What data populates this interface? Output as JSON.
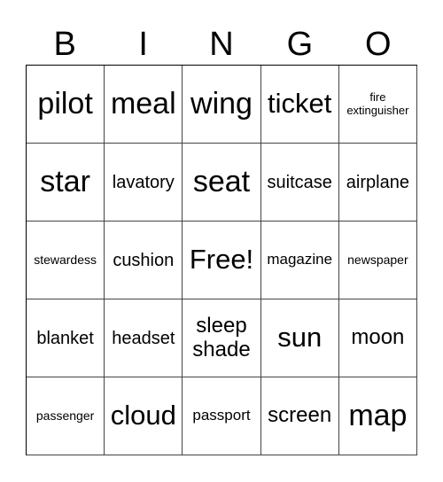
{
  "header": [
    "B",
    "I",
    "N",
    "G",
    "O"
  ],
  "cells": [
    [
      "pilot",
      "meal",
      "wing",
      "ticket",
      "fire extinguisher"
    ],
    [
      "star",
      "lavatory",
      "seat",
      "suitcase",
      "airplane"
    ],
    [
      "stewardess",
      "cushion",
      "Free!",
      "magazine",
      "newspaper"
    ],
    [
      "blanket",
      "headset",
      "sleep shade",
      "sun",
      "moon"
    ],
    [
      "passenger",
      "cloud",
      "passport",
      "screen",
      "map"
    ]
  ]
}
